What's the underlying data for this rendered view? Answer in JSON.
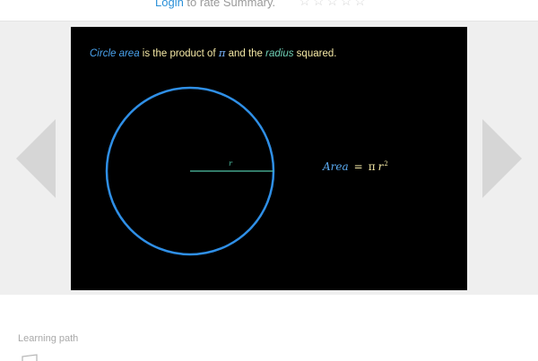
{
  "header": {
    "login_link": "Login",
    "rate_text": " to rate Summary.",
    "star_glyphs": "☆☆☆☆☆",
    "rating_max": 5,
    "rating_value": 0
  },
  "slide": {
    "caption": {
      "term": "Circle area",
      "part1": " is the product of ",
      "pi": "π",
      "part2": " and the ",
      "radius": "radius",
      "part3": " squared."
    },
    "radius_label": "r",
    "formula": {
      "lhs": "Area",
      "equals": "=",
      "pi": "π",
      "r": "r",
      "exp": "2"
    }
  },
  "nav": {
    "prev_icon": "triangle-left-icon",
    "next_icon": "triangle-right-icon"
  },
  "footer": {
    "learning_path_label": "Learning path",
    "icon": "learning-path-icon"
  },
  "colors": {
    "circle": "#2f8fe6",
    "radius_line": "#4fc3a6",
    "caption_text": "#f5e9a6",
    "slide_bg": "#000000",
    "stage_bg": "#efefef",
    "arrow": "#d6d6d6",
    "link": "#2a90d8"
  }
}
